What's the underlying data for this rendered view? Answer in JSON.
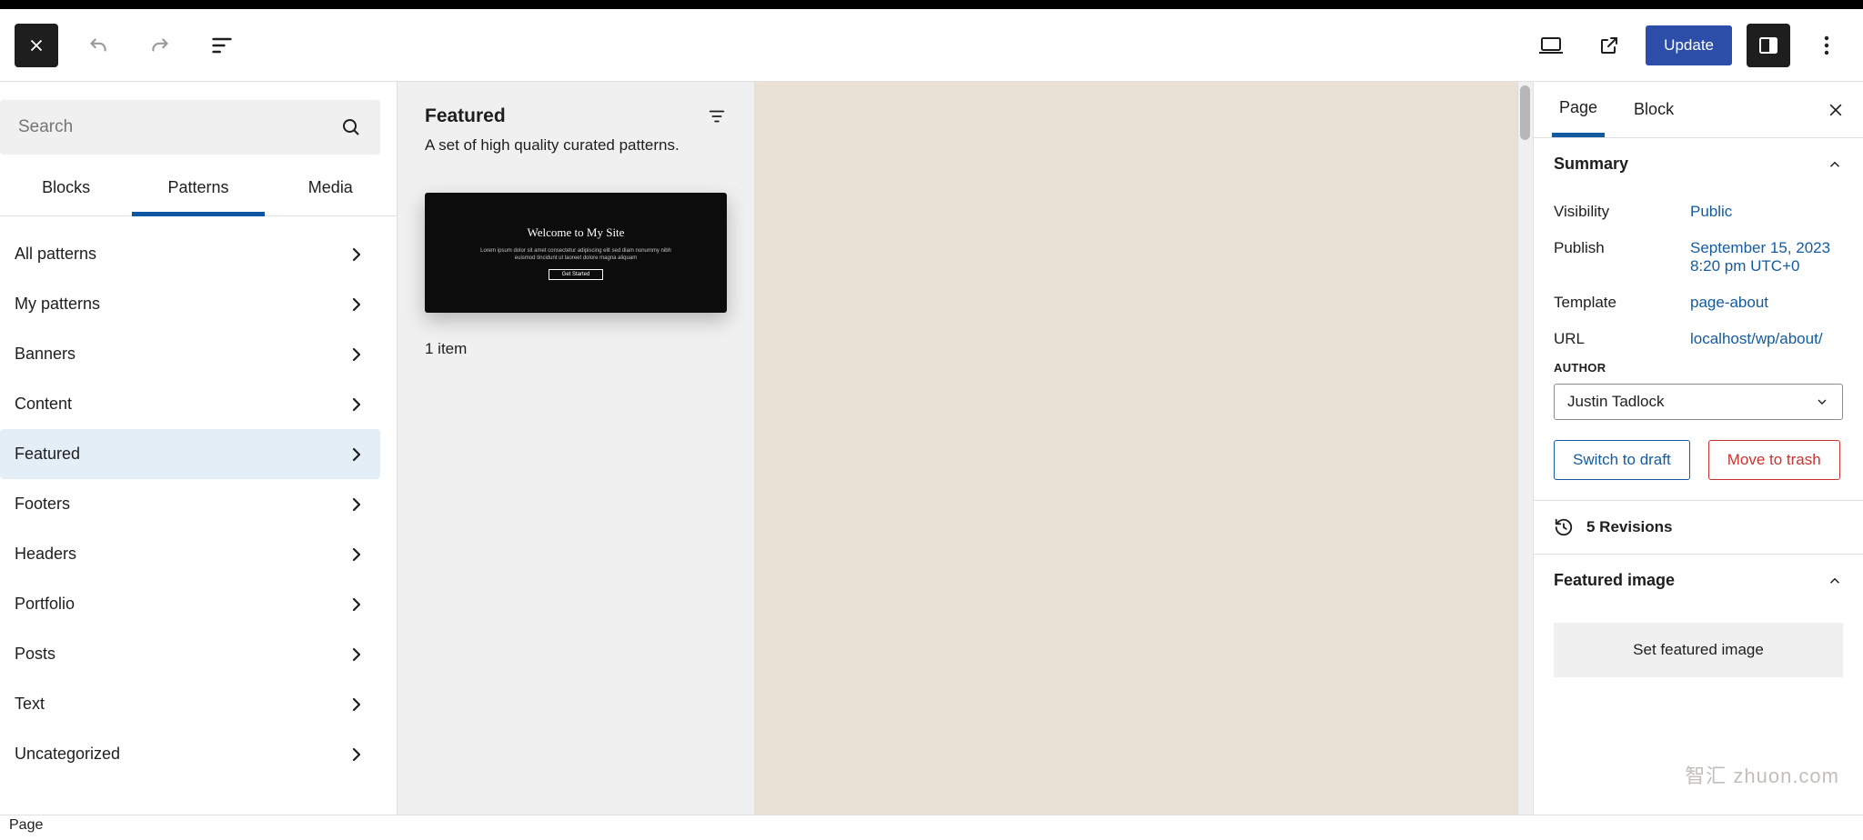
{
  "toolbar": {
    "update_label": "Update"
  },
  "inserter": {
    "search_placeholder": "Search",
    "tabs": {
      "blocks": "Blocks",
      "patterns": "Patterns",
      "media": "Media"
    },
    "categories": [
      {
        "label": "All patterns"
      },
      {
        "label": "My patterns"
      },
      {
        "label": "Banners"
      },
      {
        "label": "Content"
      },
      {
        "label": "Featured"
      },
      {
        "label": "Footers"
      },
      {
        "label": "Headers"
      },
      {
        "label": "Portfolio"
      },
      {
        "label": "Posts"
      },
      {
        "label": "Text"
      },
      {
        "label": "Uncategorized"
      }
    ]
  },
  "patterns": {
    "title": "Featured",
    "description": "A set of high quality curated patterns.",
    "thumb_title": "Welcome to My Site",
    "item_count": "1 item"
  },
  "settings": {
    "tabs": {
      "page": "Page",
      "block": "Block"
    },
    "summary": {
      "heading": "Summary",
      "visibility_label": "Visibility",
      "visibility_value": "Public",
      "publish_label": "Publish",
      "publish_value": "September 15, 2023 8:20 pm UTC+0",
      "template_label": "Template",
      "template_value": "page-about",
      "url_label": "URL",
      "url_value": "localhost/wp/about/",
      "author_label": "AUTHOR",
      "author_value": "Justin Tadlock",
      "switch_draft": "Switch to draft",
      "move_trash": "Move to trash"
    },
    "revisions": "5 Revisions",
    "featured_image": {
      "heading": "Featured image",
      "placeholder": "Set featured image"
    }
  },
  "footer": {
    "breadcrumb": "Page"
  },
  "watermark": "智汇 zhuon.com"
}
